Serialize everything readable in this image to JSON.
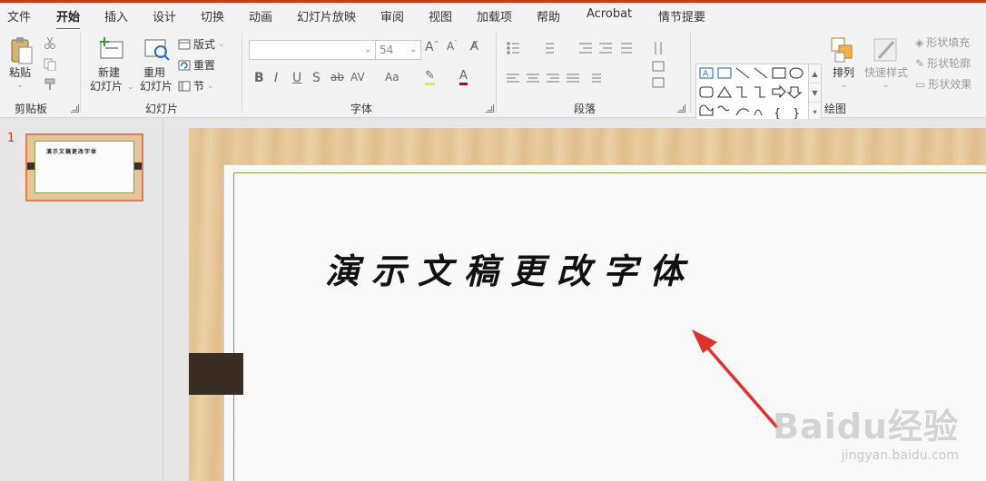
{
  "tabs": [
    "文件",
    "开始",
    "插入",
    "设计",
    "切换",
    "动画",
    "幻灯片放映",
    "审阅",
    "视图",
    "加载项",
    "帮助",
    "Acrobat",
    "情节提要"
  ],
  "active_tab": "开始",
  "ribbon": {
    "clipboard": {
      "paste": "粘贴",
      "group": "剪贴板"
    },
    "slides": {
      "new_slide_1": "新建",
      "new_slide_2": "幻灯片",
      "reuse_1": "重用",
      "reuse_2": "幻灯片",
      "layout": "版式",
      "reset": "重置",
      "section": "节",
      "group": "幻灯片"
    },
    "font": {
      "name": "",
      "size": "54",
      "group": "字体"
    },
    "paragraph": {
      "group": "段落"
    },
    "drawing": {
      "arrange": "排列",
      "quick_styles": "快速样式",
      "shape_fill": "形状填充",
      "shape_outline": "形状轮廓",
      "shape_effects": "形状效果",
      "group": "绘图"
    }
  },
  "thumbnails": [
    {
      "number": "1",
      "title": "演示文稿更改字体"
    }
  ],
  "slide": {
    "title": "演示文稿更改字体"
  },
  "watermark": {
    "main": "Baidu经验",
    "sub": "jingyan.baidu.com"
  },
  "colors": {
    "accent": "#c43e1c",
    "arrow": "#e0302a",
    "thumb_border": "#e07b57"
  }
}
